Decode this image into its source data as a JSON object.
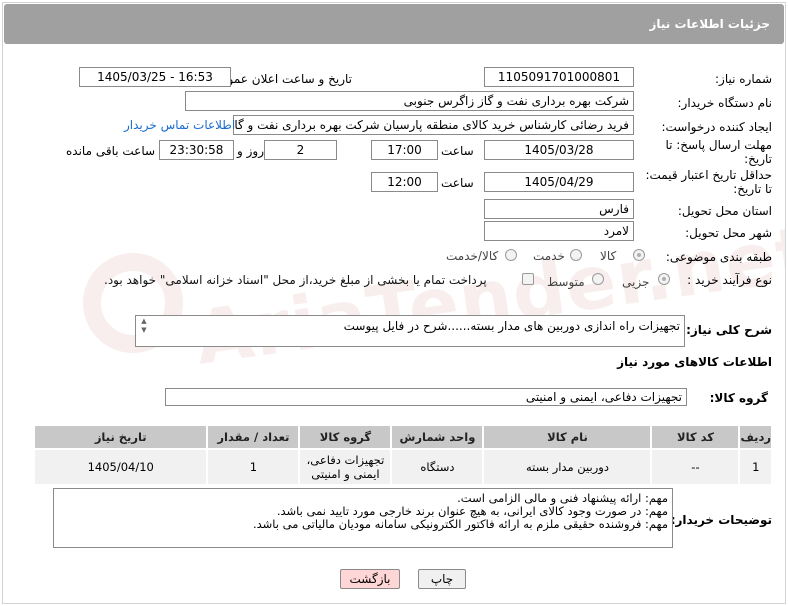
{
  "header": {
    "title": "جزئیات اطلاعات نیاز"
  },
  "need_number": {
    "label": "شماره نیاز:",
    "value": "1105091701000801"
  },
  "announce_datetime": {
    "label": "تاریخ و ساعت اعلان عمومی:",
    "value": "1405/03/25 - 16:53"
  },
  "buyer_org": {
    "label": "نام دستگاه خریدار:",
    "value": "شرکت بهره برداری نفت و گاز زاگرس جنوبی"
  },
  "requester": {
    "label": "ایجاد کننده درخواست:",
    "value": "فرید رضائی کارشناس خرید کالای منطقه پارسیان شرکت بهره برداری نفت و گاز",
    "contact_link": "اطلاعات تماس خریدار"
  },
  "reply_deadline": {
    "label": "مهلت ارسال پاسخ: تا تاریخ:",
    "date": "1405/03/28",
    "time_label": "ساعت",
    "time": "17:00",
    "days": "2",
    "days_label": "روز و",
    "remaining": "23:30:58",
    "remaining_label": "ساعت باقی مانده"
  },
  "price_validity": {
    "label": "حداقل تاریخ اعتبار قیمت: تا تاریخ:",
    "date": "1405/04/29",
    "time_label": "ساعت",
    "time": "12:00"
  },
  "province": {
    "label": "استان محل تحویل:",
    "value": "فارس"
  },
  "city": {
    "label": "شهر محل تحویل:",
    "value": "لامرد"
  },
  "category": {
    "label": "طبقه بندی موضوعی:",
    "options": [
      "کالا",
      "خدمت",
      "کالا/خدمت"
    ],
    "selected": "کالا"
  },
  "process": {
    "label": "نوع فرآیند خرید :",
    "options": [
      "جزیی",
      "متوسط"
    ],
    "selected": "جزیی",
    "payment_note": "پرداخت تمام یا بخشی از مبلغ خرید،از محل \"اسناد خزانه اسلامی\" خواهد بود."
  },
  "general_desc": {
    "label": "شرح کلی نیاز:",
    "value": "تجهیزات راه اندازی دوربین های مدار بسته......شرح در فایل پیوست"
  },
  "goods_info": {
    "title": "اطلاعات کالاهای مورد نیاز"
  },
  "goods_group": {
    "label": "گروه کالا:",
    "value": "تجهیزات دفاعی، ایمنی و امنیتی"
  },
  "table": {
    "headers": [
      "ردیف",
      "کد کالا",
      "نام کالا",
      "واحد شمارش",
      "گروه کالا",
      "تعداد / مقدار",
      "تاریخ نیاز"
    ],
    "rows": [
      [
        "1",
        "--",
        "دوربین مدار بسته",
        "دستگاه",
        "تجهیزات دفاعی، ایمنی و امنیتی",
        "1",
        "1405/04/10"
      ]
    ]
  },
  "buyer_notes": {
    "label": "توضیحات خریدار:",
    "lines": [
      "مهم: ارائه پیشنهاد فنی و مالی الزامی است.",
      "مهم:  در صورت وجود کالای ایرانی، به هیچ عنوان برند خارجی مورد تایید نمی باشد.",
      "مهم: فروشنده حقیقی ملزم به ارائه فاکتور الکترونیکی سامانه مودیان مالیاتی می باشد."
    ]
  },
  "buttons": {
    "print": "چاپ",
    "back": "بازگشت"
  },
  "watermark": "AriaTender.net",
  "colors": {
    "header_bg": "#a0a0a0",
    "link": "#1a6ccf",
    "back_btn_bg": "#ffd6d6",
    "print_btn_bg": "#f0f0f0"
  }
}
